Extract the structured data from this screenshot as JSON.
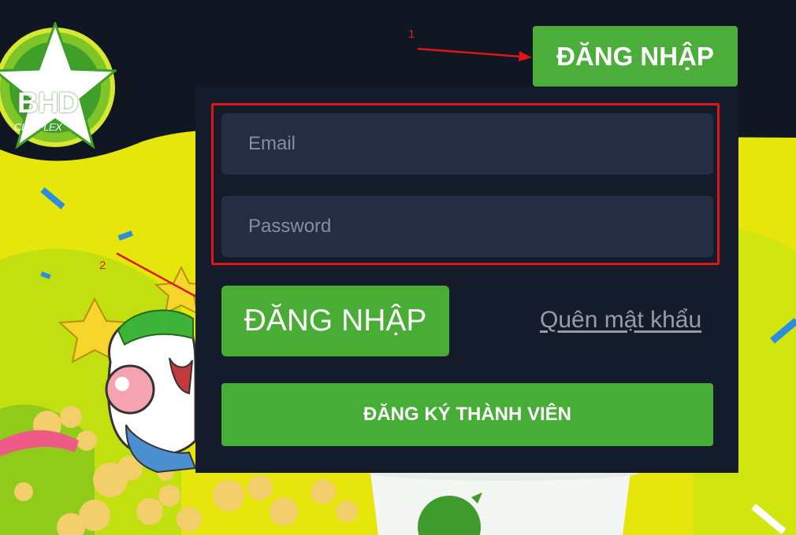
{
  "header": {
    "login_label": "ĐĂNG NHẬP",
    "logo_text": "BHD",
    "logo_subtext": "CINEPLEX"
  },
  "annotations": {
    "step1": "1",
    "step2": "2"
  },
  "login_form": {
    "email_placeholder": "Email",
    "password_placeholder": "Password",
    "login_label": "ĐĂNG NHẬP",
    "forgot_label": "Quên mật khẩu",
    "register_label": "ĐĂNG KÝ THÀNH VIÊN"
  },
  "colors": {
    "accent_green": "#4cae3a",
    "panel": "#141b2b",
    "field": "#252d43",
    "annotation_red": "#e0151a",
    "background_yellow": "#e8e60a"
  }
}
